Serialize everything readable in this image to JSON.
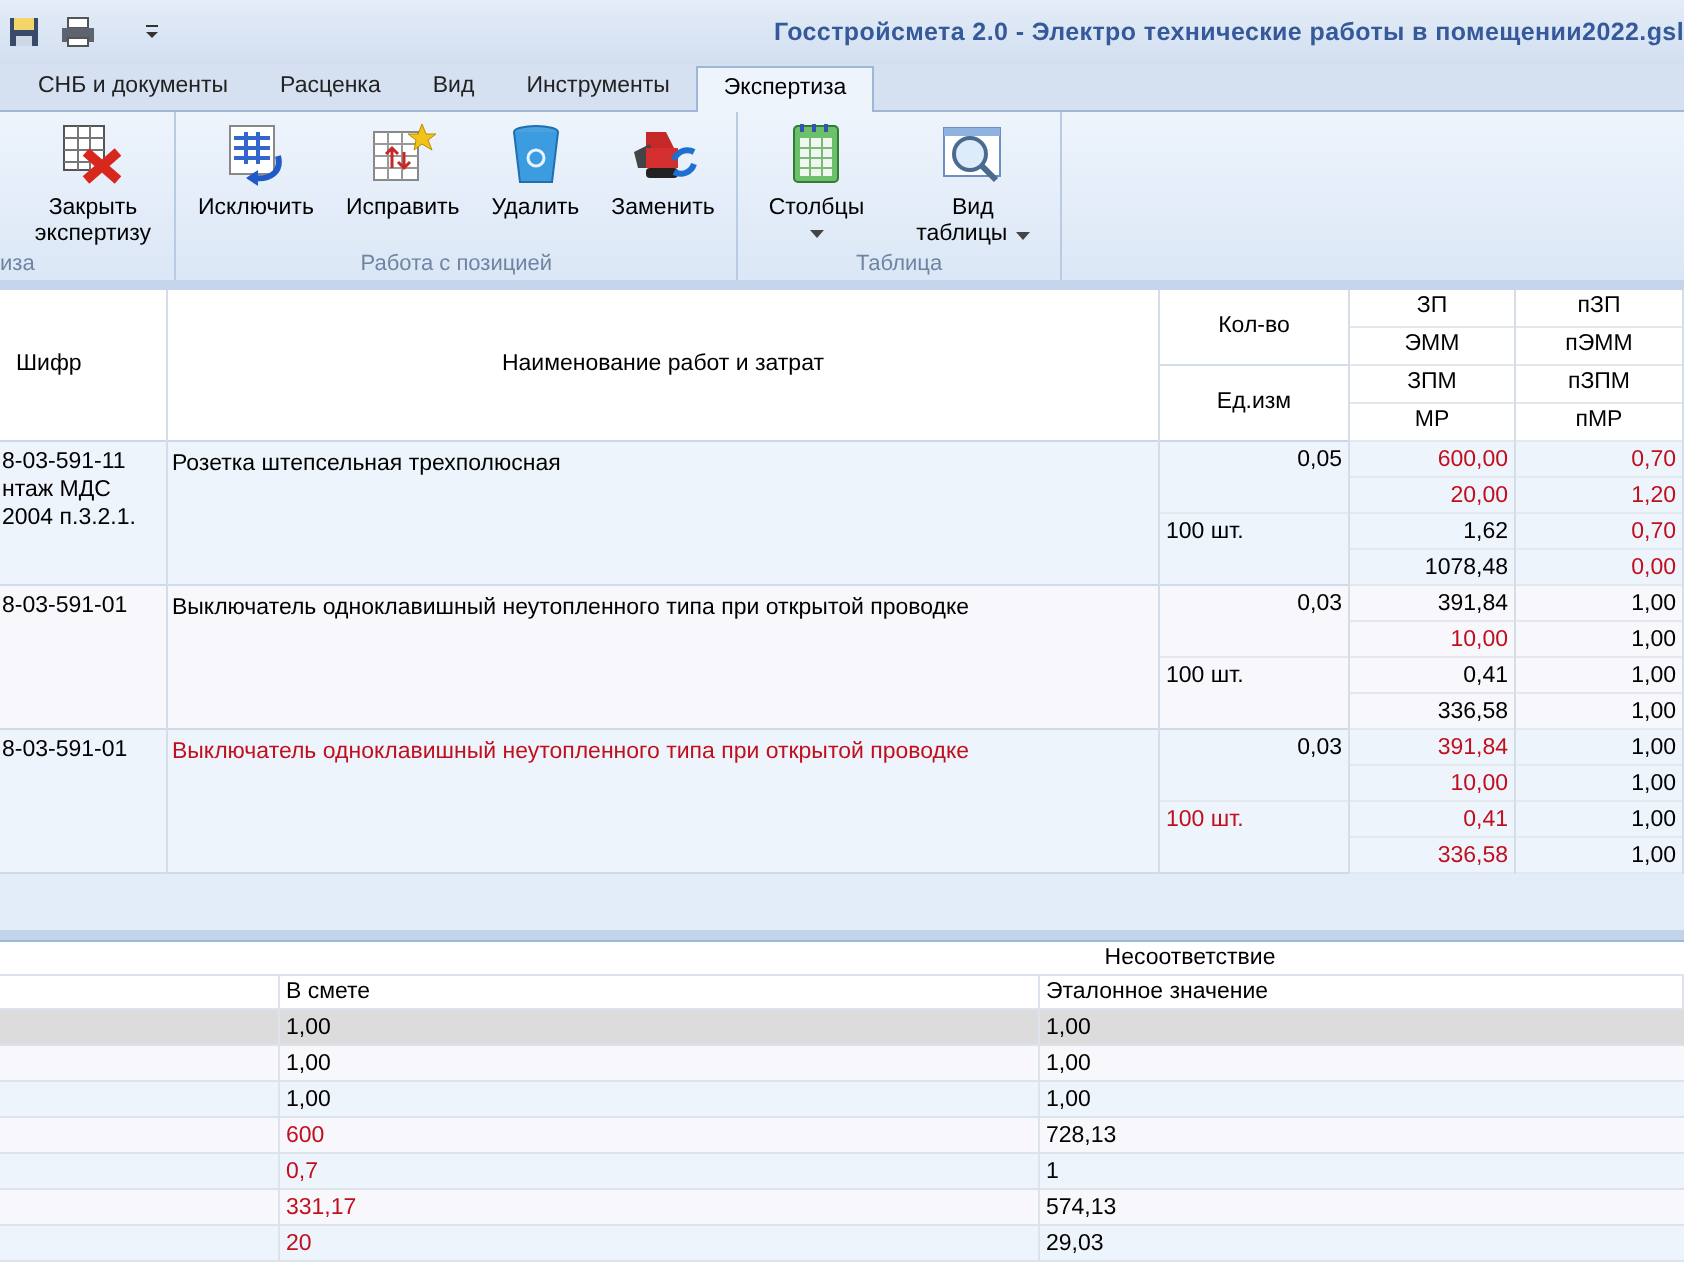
{
  "window": {
    "title": "Госстройсмета 2.0 - Электро технические работы в помещении2022.gsl"
  },
  "tabs": [
    {
      "label": "СНБ и документы",
      "selected": false
    },
    {
      "label": "Расценка",
      "selected": false
    },
    {
      "label": "Вид",
      "selected": false
    },
    {
      "label": "Инструменты",
      "selected": false
    },
    {
      "label": "Экспертиза",
      "selected": true
    }
  ],
  "ribbon": {
    "groups": [
      {
        "label": "иза",
        "buttons": [
          {
            "lines": [
              "Закрыть",
              "экспертизу"
            ],
            "kind": "close_table",
            "dropdown": false
          }
        ]
      },
      {
        "label": "Работа с позицией",
        "buttons": [
          {
            "lines": [
              "Исключить"
            ],
            "kind": "exclude",
            "dropdown": false
          },
          {
            "lines": [
              "Исправить"
            ],
            "kind": "fix",
            "dropdown": false
          },
          {
            "lines": [
              "Удалить"
            ],
            "kind": "trash",
            "dropdown": false
          },
          {
            "lines": [
              "Заменить"
            ],
            "kind": "replace",
            "dropdown": false
          }
        ]
      },
      {
        "label": "Таблица",
        "buttons": [
          {
            "lines": [
              "Столбцы"
            ],
            "kind": "columns",
            "dropdown": true
          },
          {
            "lines": [
              "Вид",
              "таблицы"
            ],
            "kind": "view",
            "dropdown": true
          }
        ]
      }
    ]
  },
  "grid": {
    "columns": {
      "code": "Шифр",
      "name": "Наименование работ и затрат",
      "qty": "Кол-во",
      "unit": "Ед.изм",
      "col_a": [
        "ЗП",
        "ЭММ",
        "ЗПМ",
        "МР"
      ],
      "col_b": [
        "пЗП",
        "пЭММ",
        "пЗПМ",
        "пМР"
      ]
    },
    "rows": [
      {
        "code": [
          "8-03-591-11",
          "нтаж МДС",
          "2004 п.3.2.1."
        ],
        "name": "Розетка штепсельная трехполюсная",
        "name_flagged": false,
        "qty": "0,05",
        "unit": "100 шт.",
        "unit_flagged": false,
        "col_a": [
          {
            "text": "600,00",
            "flagged": true
          },
          {
            "text": "20,00",
            "flagged": true
          },
          {
            "text": "1,62",
            "flagged": false
          },
          {
            "text": "1078,48",
            "flagged": false
          }
        ],
        "col_b": [
          {
            "text": "0,70",
            "flagged": true
          },
          {
            "text": "1,20",
            "flagged": true
          },
          {
            "text": "0,70",
            "flagged": true
          },
          {
            "text": "0,00",
            "flagged": true
          }
        ]
      },
      {
        "code": [
          "8-03-591-01"
        ],
        "name": "Выключатель одноклавишный неутопленного типа при открытой проводке",
        "name_flagged": false,
        "qty": "0,03",
        "unit": "100 шт.",
        "unit_flagged": false,
        "col_a": [
          {
            "text": "391,84",
            "flagged": false
          },
          {
            "text": "10,00",
            "flagged": true
          },
          {
            "text": "0,41",
            "flagged": false
          },
          {
            "text": "336,58",
            "flagged": false
          }
        ],
        "col_b": [
          {
            "text": "1,00",
            "flagged": false
          },
          {
            "text": "1,00",
            "flagged": false
          },
          {
            "text": "1,00",
            "flagged": false
          },
          {
            "text": "1,00",
            "flagged": false
          }
        ]
      },
      {
        "code": [
          "8-03-591-01"
        ],
        "name": "Выключатель одноклавишный неутопленного типа при открытой проводке",
        "name_flagged": true,
        "qty": "0,03",
        "unit": "100 шт.",
        "unit_flagged": true,
        "col_a": [
          {
            "text": "391,84",
            "flagged": true
          },
          {
            "text": "10,00",
            "flagged": true
          },
          {
            "text": "0,41",
            "flagged": true
          },
          {
            "text": "336,58",
            "flagged": true
          }
        ],
        "col_b": [
          {
            "text": "1,00",
            "flagged": false
          },
          {
            "text": "1,00",
            "flagged": false
          },
          {
            "text": "1,00",
            "flagged": false
          },
          {
            "text": "1,00",
            "flagged": false
          }
        ]
      }
    ]
  },
  "mismatch": {
    "group": "Несоответствие",
    "columns": [
      "В смете",
      "Эталонное значение"
    ],
    "rows": [
      {
        "estimate": "1,00",
        "estimate_flagged": false,
        "reference": "1,00",
        "selected": true
      },
      {
        "estimate": "1,00",
        "estimate_flagged": false,
        "reference": "1,00",
        "selected": false
      },
      {
        "estimate": "1,00",
        "estimate_flagged": false,
        "reference": "1,00",
        "selected": false
      },
      {
        "estimate": "600",
        "estimate_flagged": true,
        "reference": "728,13",
        "selected": false
      },
      {
        "estimate": "0,7",
        "estimate_flagged": true,
        "reference": "1",
        "selected": false
      },
      {
        "estimate": "331,17",
        "estimate_flagged": true,
        "reference": "574,13",
        "selected": false
      },
      {
        "estimate": "20",
        "estimate_flagged": true,
        "reference": "29,03",
        "selected": false
      }
    ]
  }
}
